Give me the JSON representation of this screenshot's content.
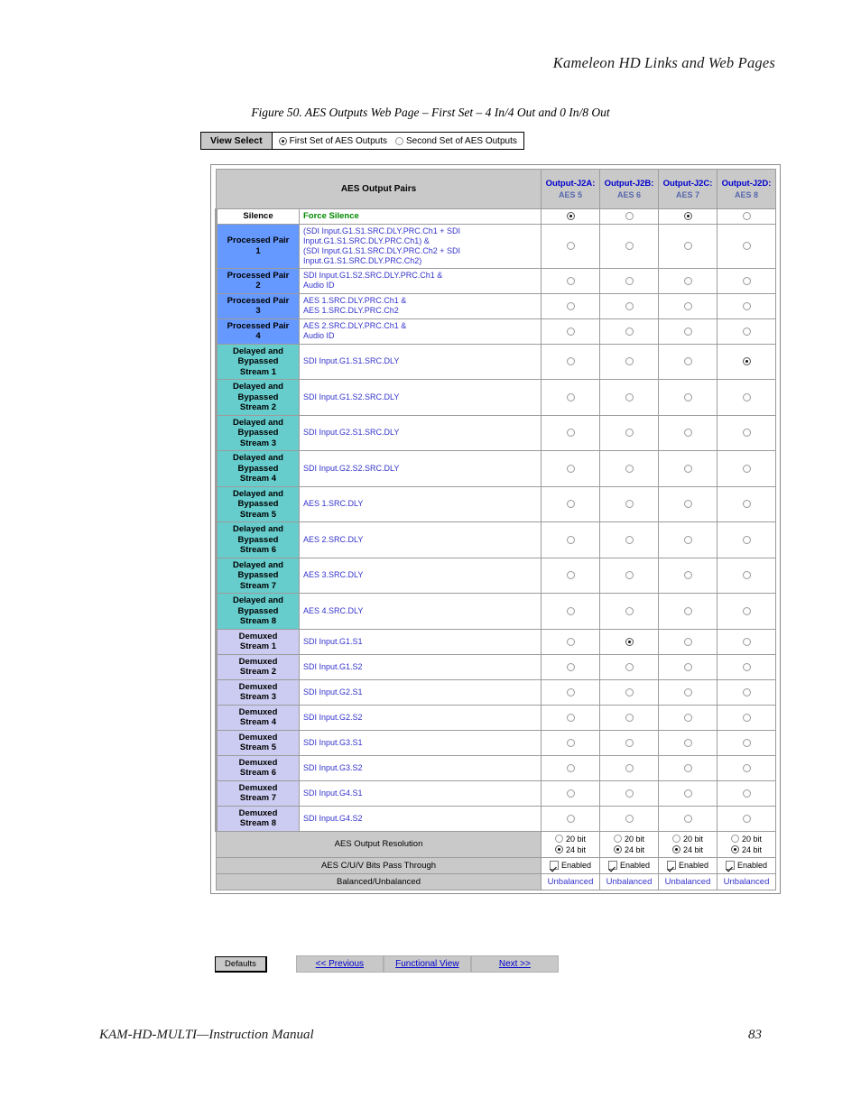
{
  "running_head": "Kameleon HD Links and Web Pages",
  "figure_caption": "Figure 50.  AES Outputs Web Page – First Set – 4 In/4 Out and 0 In/8 Out",
  "view_select": {
    "label": "View Select",
    "options": [
      {
        "label": "First Set of AES Outputs",
        "selected": true
      },
      {
        "label": "Second Set of AES Outputs",
        "selected": false
      }
    ]
  },
  "table": {
    "header_main": "AES Output Pairs",
    "columns": [
      {
        "name": "Output-J2A:",
        "sub": "AES 5"
      },
      {
        "name": "Output-J2B:",
        "sub": "AES 6"
      },
      {
        "name": "Output-J2C:",
        "sub": "AES 7"
      },
      {
        "name": "Output-J2D:",
        "sub": "AES 8"
      }
    ],
    "rows": [
      {
        "category": "Silence",
        "style": "silence",
        "description": "Force Silence",
        "desc_style": "force",
        "selected": [
          true,
          false,
          true,
          false
        ]
      },
      {
        "category": "Processed Pair\n1",
        "style": "pp",
        "description": "(SDI Input.G1.S1.SRC.DLY.PRC.Ch1 + SDI Input.G1.S1.SRC.DLY.PRC.Ch1) &\n(SDI Input.G1.S1.SRC.DLY.PRC.Ch2 + SDI Input.G1.S1.SRC.DLY.PRC.Ch2)",
        "selected": [
          false,
          false,
          false,
          false
        ]
      },
      {
        "category": "Processed Pair\n2",
        "style": "pp",
        "description": "SDI Input.G1.S2.SRC.DLY.PRC.Ch1 &\nAudio ID",
        "selected": [
          false,
          false,
          false,
          false
        ]
      },
      {
        "category": "Processed Pair\n3",
        "style": "pp",
        "description": "AES 1.SRC.DLY.PRC.Ch1 &\nAES 1.SRC.DLY.PRC.Ch2",
        "selected": [
          false,
          false,
          false,
          false
        ]
      },
      {
        "category": "Processed Pair\n4",
        "style": "pp",
        "description": "AES 2.SRC.DLY.PRC.Ch1 &\nAudio ID",
        "selected": [
          false,
          false,
          false,
          false
        ]
      },
      {
        "category": "Delayed and\nBypassed\nStream 1",
        "style": "db",
        "description": "SDI Input.G1.S1.SRC.DLY",
        "selected": [
          false,
          false,
          false,
          true
        ]
      },
      {
        "category": "Delayed and\nBypassed\nStream 2",
        "style": "db",
        "description": "SDI Input.G1.S2.SRC.DLY",
        "selected": [
          false,
          false,
          false,
          false
        ]
      },
      {
        "category": "Delayed and\nBypassed\nStream 3",
        "style": "db",
        "description": "SDI Input.G2.S1.SRC.DLY",
        "selected": [
          false,
          false,
          false,
          false
        ]
      },
      {
        "category": "Delayed and\nBypassed\nStream 4",
        "style": "db",
        "description": "SDI Input.G2.S2.SRC.DLY",
        "selected": [
          false,
          false,
          false,
          false
        ]
      },
      {
        "category": "Delayed and\nBypassed\nStream 5",
        "style": "db",
        "description": "AES 1.SRC.DLY",
        "selected": [
          false,
          false,
          false,
          false
        ]
      },
      {
        "category": "Delayed and\nBypassed\nStream 6",
        "style": "db",
        "description": "AES 2.SRC.DLY",
        "selected": [
          false,
          false,
          false,
          false
        ]
      },
      {
        "category": "Delayed and\nBypassed\nStream 7",
        "style": "db",
        "description": "AES 3.SRC.DLY",
        "selected": [
          false,
          false,
          false,
          false
        ]
      },
      {
        "category": "Delayed and\nBypassed\nStream 8",
        "style": "db",
        "description": "AES 4.SRC.DLY",
        "selected": [
          false,
          false,
          false,
          false
        ]
      },
      {
        "category": "Demuxed\nStream 1",
        "style": "dm",
        "description": "SDI Input.G1.S1",
        "selected": [
          false,
          true,
          false,
          false
        ]
      },
      {
        "category": "Demuxed\nStream 2",
        "style": "dm",
        "description": "SDI Input.G1.S2",
        "selected": [
          false,
          false,
          false,
          false
        ]
      },
      {
        "category": "Demuxed\nStream 3",
        "style": "dm",
        "description": "SDI Input.G2.S1",
        "selected": [
          false,
          false,
          false,
          false
        ]
      },
      {
        "category": "Demuxed\nStream 4",
        "style": "dm",
        "description": "SDI Input.G2.S2",
        "selected": [
          false,
          false,
          false,
          false
        ]
      },
      {
        "category": "Demuxed\nStream 5",
        "style": "dm",
        "description": "SDI Input.G3.S1",
        "selected": [
          false,
          false,
          false,
          false
        ]
      },
      {
        "category": "Demuxed\nStream 6",
        "style": "dm",
        "description": "SDI Input.G3.S2",
        "selected": [
          false,
          false,
          false,
          false
        ]
      },
      {
        "category": "Demuxed\nStream 7",
        "style": "dm",
        "description": "SDI Input.G4.S1",
        "selected": [
          false,
          false,
          false,
          false
        ]
      },
      {
        "category": "Demuxed\nStream 8",
        "style": "dm",
        "description": "SDI Input.G4.S2",
        "selected": [
          false,
          false,
          false,
          false
        ]
      }
    ],
    "settings": {
      "resolution": {
        "label": "AES Output Resolution",
        "option_a": "20 bit",
        "option_b": "24 bit",
        "values": [
          "24 bit",
          "24 bit",
          "24 bit",
          "24 bit"
        ]
      },
      "cuv": {
        "label": "AES C/U/V Bits Pass Through",
        "option": "Enabled",
        "checked": [
          true,
          true,
          true,
          true
        ]
      },
      "balanced": {
        "label": "Balanced/Unbalanced",
        "values": [
          "Unbalanced",
          "Unbalanced",
          "Unbalanced",
          "Unbalanced"
        ]
      }
    }
  },
  "buttons": {
    "defaults": "Defaults",
    "previous": "<< Previous",
    "functional_view": "Functional View",
    "next": "Next >>"
  },
  "footer": {
    "left": "KAM-HD-MULTI—Instruction Manual",
    "page": "83"
  },
  "colors": {
    "processed_pair": "#6699ff",
    "delayed_bypassed": "#66cccc",
    "demuxed": "#ccccf2",
    "header_gray": "#c9c9c9",
    "link_blue": "#0000cc",
    "desc_blue": "#3333cc",
    "force_silence_green": "#008800"
  }
}
